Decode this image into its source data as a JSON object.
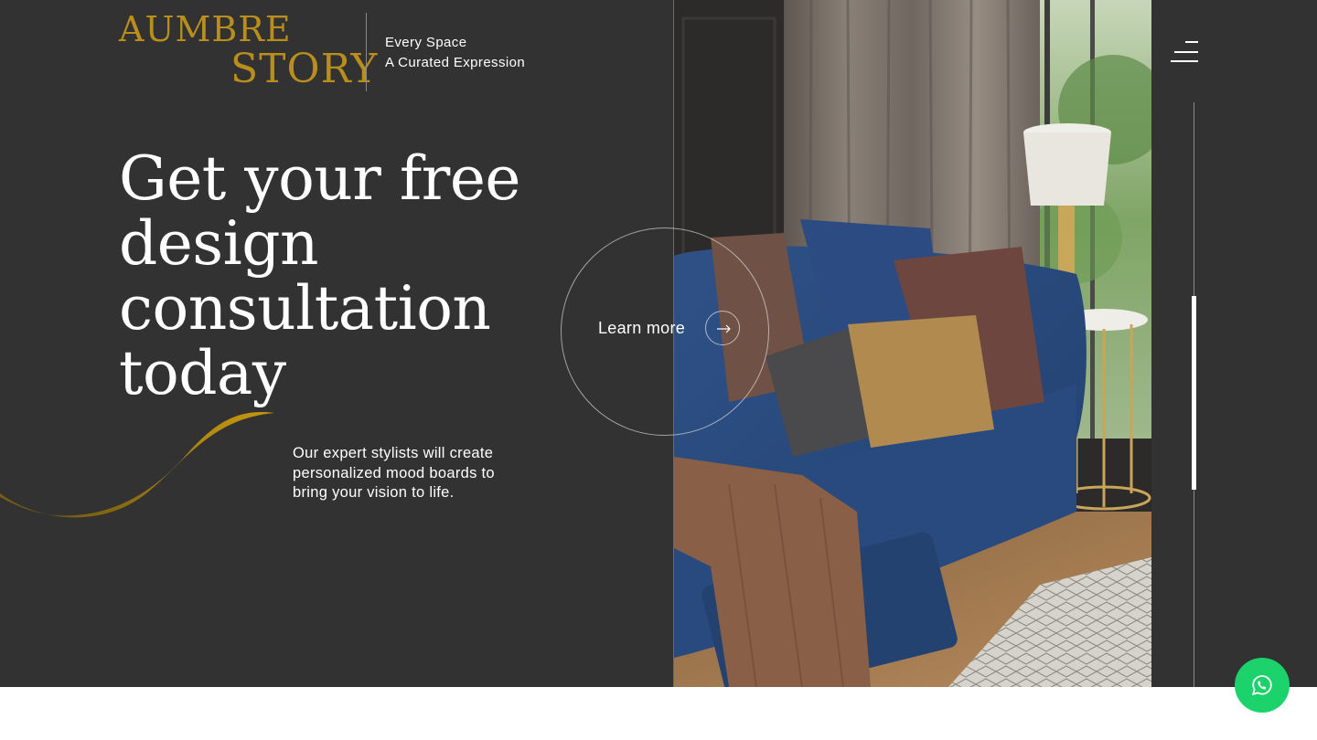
{
  "brand": {
    "logo_line1": "AUMBRE",
    "logo_line2": "STORY",
    "tagline_line1": "Every Space",
    "tagline_line2": "A Curated Expression",
    "logo_color": "#b98e1c"
  },
  "hero": {
    "headline": "Get your free design consultation today",
    "subcopy": "Our expert stylists will create personalized mood boards to bring your vision to life.",
    "cta_label": "Learn more",
    "background": "#323232",
    "accent": "#b98e1c"
  },
  "nav": {
    "menu_icon": "hamburger-menu-icon",
    "scroll_progress": 0.33
  },
  "floating": {
    "whatsapp_icon": "whatsapp-icon",
    "whatsapp_color": "#1cd36b"
  }
}
